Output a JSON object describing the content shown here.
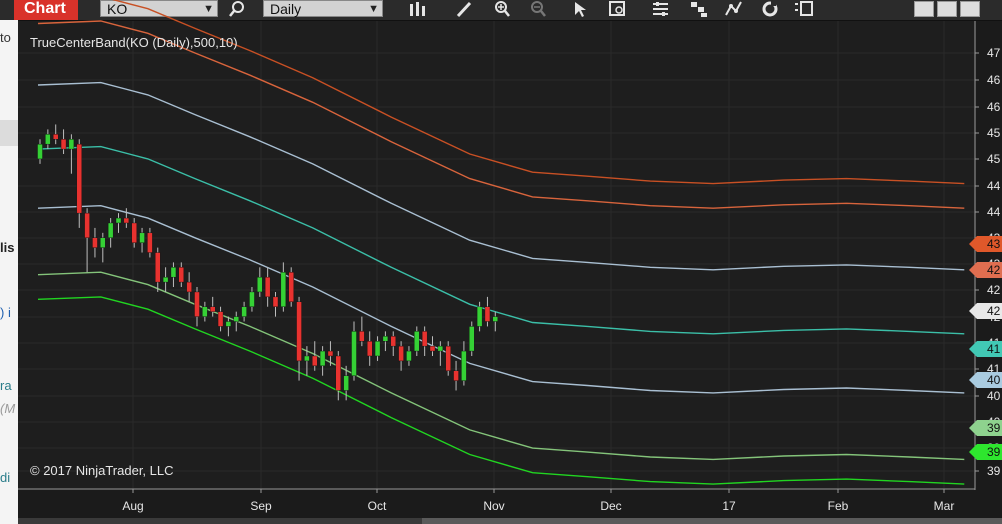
{
  "toolbar": {
    "tab_label": "Chart",
    "instrument": "KO",
    "interval": "Daily",
    "icons": [
      "search-icon",
      "bars-type-icon",
      "pencil-icon",
      "zoom-in-icon",
      "zoom-out-icon",
      "pointer-icon",
      "data-box-icon",
      "chart-properties-icon",
      "strategies-icon",
      "indicators-icon",
      "refresh-icon",
      "templates-icon"
    ]
  },
  "left_panel": {
    "fragments": [
      "to",
      "lis",
      ") i",
      "ra",
      "(M",
      "di"
    ]
  },
  "chart_data": {
    "type": "candlestick",
    "indicator_label": "TrueCenterBand(KO (Daily),500,10)",
    "copyright": "© 2017 NinjaTrader, LLC",
    "x_tick_labels": [
      "Aug",
      "Sep",
      "Oct",
      "Nov",
      "Dec",
      "17",
      "Feb",
      "Mar"
    ],
    "y_tick_labels": [
      "47",
      "46",
      "46",
      "45",
      "45",
      "44",
      "44",
      "43",
      "43",
      "42",
      "42",
      "41",
      "41",
      "40",
      "40",
      "39",
      "39"
    ],
    "y_range": [
      38.3,
      47.8
    ],
    "grid": true,
    "price_markers": [
      {
        "label": "43",
        "color": "#e0582a"
      },
      {
        "label": "42",
        "color": "#e06e50"
      },
      {
        "label": "42",
        "color": "#e8e8e8"
      },
      {
        "label": "41",
        "color": "#41c8b4"
      },
      {
        "label": "40",
        "color": "#a9cbe0"
      },
      {
        "label": "39",
        "color": "#8ed28e"
      },
      {
        "label": "39",
        "color": "#2ee62e"
      }
    ],
    "band_colors": [
      "#c85024",
      "#d8643c",
      "#a9bfd2",
      "#3bbfa8",
      "#a9bfd2",
      "#84c47a",
      "#21d521"
    ],
    "band_offsets": [
      3.05,
      2.55,
      1.3,
      0,
      -1.2,
      -2.55,
      -3.05
    ],
    "center": [
      {
        "x": 0,
        "y": 45.2
      },
      {
        "x": 8,
        "y": 45.25
      },
      {
        "x": 14,
        "y": 45.0
      },
      {
        "x": 20,
        "y": 44.6
      },
      {
        "x": 27,
        "y": 44.15
      },
      {
        "x": 35,
        "y": 43.6
      },
      {
        "x": 45,
        "y": 42.8
      },
      {
        "x": 55,
        "y": 42.05
      },
      {
        "x": 63,
        "y": 41.68
      },
      {
        "x": 70,
        "y": 41.6
      },
      {
        "x": 78,
        "y": 41.5
      },
      {
        "x": 86,
        "y": 41.45
      },
      {
        "x": 95,
        "y": 41.52
      },
      {
        "x": 103,
        "y": 41.55
      },
      {
        "x": 111,
        "y": 41.5
      },
      {
        "x": 118,
        "y": 41.45
      }
    ],
    "candles_ohlc": [
      [
        45.0,
        45.4,
        44.9,
        45.3
      ],
      [
        45.3,
        45.6,
        45.2,
        45.5
      ],
      [
        45.5,
        45.7,
        45.3,
        45.4
      ],
      [
        45.4,
        45.6,
        45.1,
        45.2
      ],
      [
        45.2,
        45.5,
        44.7,
        45.4
      ],
      [
        45.3,
        45.4,
        43.6,
        43.9
      ],
      [
        43.9,
        44.0,
        42.7,
        43.4
      ],
      [
        43.4,
        43.6,
        43.0,
        43.2
      ],
      [
        43.2,
        43.5,
        42.9,
        43.4
      ],
      [
        43.4,
        43.8,
        43.2,
        43.7
      ],
      [
        43.7,
        43.9,
        43.5,
        43.8
      ],
      [
        43.8,
        44.0,
        43.6,
        43.7
      ],
      [
        43.7,
        43.8,
        43.2,
        43.3
      ],
      [
        43.3,
        43.6,
        43.1,
        43.5
      ],
      [
        43.5,
        43.6,
        43.0,
        43.1
      ],
      [
        43.1,
        43.2,
        42.3,
        42.5
      ],
      [
        42.5,
        42.8,
        42.3,
        42.6
      ],
      [
        42.6,
        42.9,
        42.4,
        42.8
      ],
      [
        42.8,
        42.9,
        42.4,
        42.5
      ],
      [
        42.5,
        42.7,
        42.1,
        42.3
      ],
      [
        42.3,
        42.4,
        41.6,
        41.8
      ],
      [
        41.8,
        42.1,
        41.7,
        42.0
      ],
      [
        42.0,
        42.2,
        41.8,
        41.9
      ],
      [
        41.9,
        42.0,
        41.5,
        41.6
      ],
      [
        41.6,
        41.8,
        41.4,
        41.7
      ],
      [
        41.7,
        41.9,
        41.5,
        41.8
      ],
      [
        41.8,
        42.1,
        41.7,
        42.0
      ],
      [
        42.0,
        42.4,
        41.9,
        42.3
      ],
      [
        42.3,
        42.8,
        42.2,
        42.6
      ],
      [
        42.6,
        42.8,
        42.0,
        42.2
      ],
      [
        42.2,
        42.3,
        41.8,
        42.0
      ],
      [
        42.0,
        42.9,
        41.9,
        42.7
      ],
      [
        42.7,
        42.8,
        42.0,
        42.1
      ],
      [
        42.1,
        42.2,
        40.5,
        40.9
      ],
      [
        40.9,
        41.2,
        40.6,
        41.0
      ],
      [
        41.0,
        41.3,
        40.7,
        40.8
      ],
      [
        40.8,
        41.2,
        40.6,
        41.1
      ],
      [
        41.1,
        41.3,
        40.8,
        41.0
      ],
      [
        41.0,
        41.1,
        40.1,
        40.3
      ],
      [
        40.3,
        40.8,
        40.1,
        40.6
      ],
      [
        40.6,
        41.7,
        40.5,
        41.5
      ],
      [
        41.5,
        41.8,
        41.2,
        41.3
      ],
      [
        41.3,
        41.5,
        40.8,
        41.0
      ],
      [
        41.0,
        41.4,
        40.9,
        41.3
      ],
      [
        41.3,
        41.5,
        41.1,
        41.4
      ],
      [
        41.4,
        41.5,
        41.0,
        41.2
      ],
      [
        41.2,
        41.3,
        40.7,
        40.9
      ],
      [
        40.9,
        41.2,
        40.8,
        41.1
      ],
      [
        41.1,
        41.6,
        41.0,
        41.5
      ],
      [
        41.5,
        41.6,
        41.0,
        41.2
      ],
      [
        41.2,
        41.4,
        41.0,
        41.1
      ],
      [
        41.1,
        41.3,
        40.8,
        41.2
      ],
      [
        41.2,
        41.3,
        40.6,
        40.7
      ],
      [
        40.7,
        40.9,
        40.3,
        40.5
      ],
      [
        40.5,
        41.3,
        40.4,
        41.1
      ],
      [
        41.1,
        41.7,
        41.0,
        41.6
      ],
      [
        41.6,
        42.1,
        41.5,
        42.0
      ],
      [
        42.0,
        42.2,
        41.6,
        41.7
      ],
      [
        41.7,
        41.9,
        41.5,
        41.8
      ]
    ]
  }
}
